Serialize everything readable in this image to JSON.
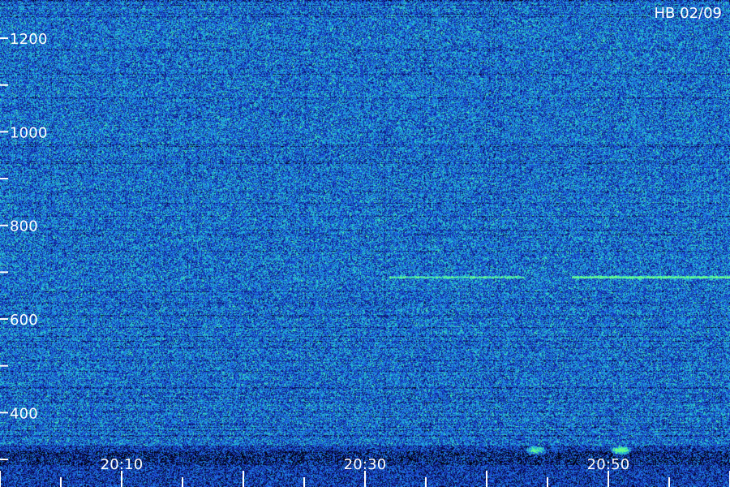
{
  "station_date": "HB 02/09",
  "chart_data": {
    "type": "heatmap",
    "title": "HB 02/09",
    "xlabel": "",
    "ylabel": "",
    "y_axis": {
      "labels": [
        "1200",
        "1000",
        "800",
        "600",
        "400"
      ],
      "ylim": [
        300,
        1240
      ]
    },
    "x_axis": {
      "labels": [
        "20:10",
        "20:30",
        "20:50"
      ],
      "xlim": [
        "20:00",
        "21:00"
      ]
    },
    "colormap": [
      "#000000",
      "#0b0f6a",
      "#1734b8",
      "#1e5ee8",
      "#1f9be0",
      "#27d7c9",
      "#6cff8a"
    ],
    "features": [
      {
        "name": "",
        "type": "horizontal_line",
        "y": 690,
        "x_start": "20:32",
        "x_end": "20:43",
        "intensity": 0.65
      },
      {
        "name": "",
        "type": "horizontal_line",
        "y": 690,
        "x_start": "20:47",
        "x_end": "21:00",
        "intensity": 0.95
      },
      {
        "name": "",
        "type": "burst",
        "x": "20:51",
        "y": 320,
        "intensity": 1.0
      },
      {
        "name": "",
        "type": "burst",
        "x": "20:44",
        "y": 320,
        "intensity": 0.75
      }
    ]
  }
}
